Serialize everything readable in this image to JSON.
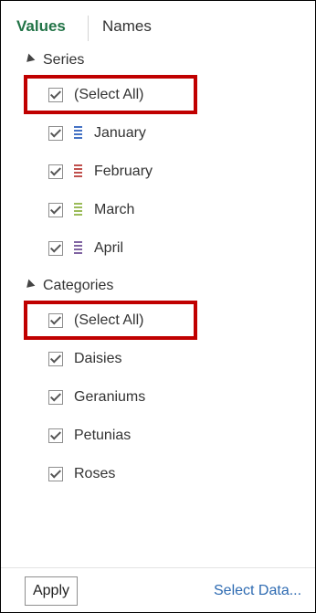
{
  "tabs": {
    "values": "Values",
    "names": "Names"
  },
  "series": {
    "header": "Series",
    "select_all": "(Select All)",
    "items": [
      {
        "label": "January",
        "color": "#4472c4",
        "checked": true
      },
      {
        "label": "February",
        "color": "#c0504d",
        "checked": true
      },
      {
        "label": "March",
        "color": "#9bbb59",
        "checked": true
      },
      {
        "label": "April",
        "color": "#8064a2",
        "checked": true
      }
    ]
  },
  "categories": {
    "header": "Categories",
    "select_all": "(Select All)",
    "items": [
      {
        "label": "Daisies",
        "checked": true
      },
      {
        "label": "Geraniums",
        "checked": true
      },
      {
        "label": "Petunias",
        "checked": true
      },
      {
        "label": "Roses",
        "checked": true
      }
    ]
  },
  "footer": {
    "apply": "Apply",
    "select_data": "Select Data..."
  },
  "colors": {
    "accent": "#217346",
    "highlight": "#c00000",
    "link": "#2e6bb2"
  }
}
